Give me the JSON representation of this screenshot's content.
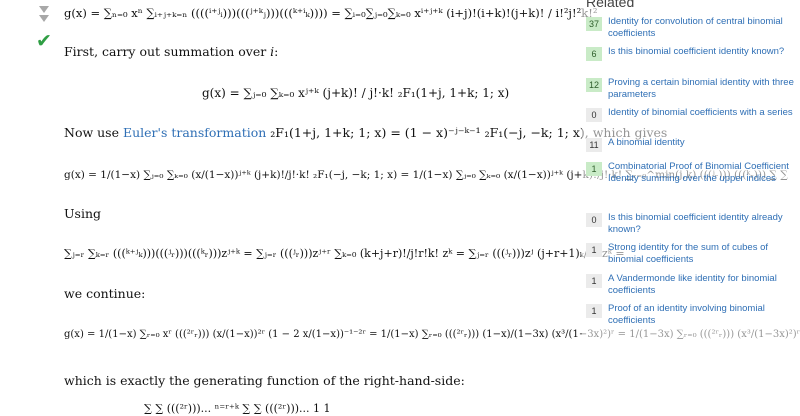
{
  "answer": {
    "eq1": "g(x) = ∑ₙ₌₀ xⁿ ∑ᵢ₊ⱼ₊ₖ₌ₙ ((((ⁱ⁺ʲᵢ)))(((ʲ⁺ᵏⱼ)))(((ᵏ⁺ⁱₖ)))) = ∑ᵢ₌₀∑ⱼ₌₀∑ₖ₌₀ xⁱ⁺ʲ⁺ᵏ (i+j)!(i+k)!(j+k)! / i!²j!²k!²",
    "p1_prefix": "First, carry out summation over ",
    "p1_var": "i",
    "p1_suffix": ":",
    "eq2": "g(x) = ∑ⱼ₌₀ ∑ₖ₌₀ xʲ⁺ᵏ (j+k)! / j!·k! ₂F₁(1+j, 1+k; 1; x)",
    "p2_prefix": "Now use ",
    "p2_link": "Euler's transformation",
    "p2_suffix": " ₂F₁(1+j, 1+k; 1; x) = (1 − x)⁻ʲ⁻ᵏ⁻¹ ₂F₁(−j, −k; 1; x), which gives",
    "eq3": "g(x) = 1/(1−x) ∑ⱼ₌₀ ∑ₖ₌₀ (x/(1−x))ʲ⁺ᵏ (j+k)!/j!·k! ₂F₁(−j, −k; 1; x) = 1/(1−x) ∑ⱼ₌₀ ∑ₖ₌₀ (x/(1−x))ʲ⁺ᵏ (j+k)!/j!·k! ∑ᵣ₌₀^min(j,k) (((ʲᵣ))) (((ᵏᵣ))) ∑ ∑",
    "p3": "Using",
    "eq4": "∑ⱼ₌ᵣ ∑ₖ₌ᵣ (((ᵏ⁺ʲₖ)))(((ʲᵣ)))(((ᵏᵣ)))zʲ⁺ᵏ = ∑ⱼ₌ᵣ (((ʲᵣ)))zʲ⁺ʳ ∑ₖ₌₀ (k+j+r)!/j!r!k! zᵏ = ∑ⱼ₌ᵣ (((ʲᵣ)))zʲ (j+r+1)ₖ/k! zᵏ =",
    "p4": "we continue:",
    "eq5": "g(x) = 1/(1−x) ∑ᵣ₌₀ xʳ (((²ʳᵣ))) (x/(1−x))²ʳ (1 − 2 x/(1−x))⁻¹⁻²ʳ = 1/(1−x) ∑ᵣ₌₀ (((²ʳᵣ))) (1−x)/(1−3x) (x³/(1−3x)²)ʳ = 1/(1−3x) ∑ᵣ₌₀ (((²ʳᵣ))) (x³/(1−3x)²)ʳ",
    "p5": "which is exactly the generating function of the right-hand-side:",
    "eq6": "∑ ∑ (((²ʳ)))... ⁿ⁼ʳ⁺ᵏ ∑ ∑ (((²ʳ)))... 1 1"
  },
  "related": {
    "title": "Related",
    "items": [
      {
        "count": "37",
        "positive": true,
        "title": "Identity for convolution of central binomial coefficients"
      },
      {
        "count": "6",
        "positive": true,
        "title": "Is this binomial coefficient identity known?"
      },
      {
        "count": "12",
        "positive": true,
        "title": "Proving a certain binomial identity with three parameters"
      },
      {
        "count": "0",
        "positive": false,
        "title": "Identity of binomial coefficients with a series"
      },
      {
        "count": "11",
        "positive": false,
        "title": "A binomial identity"
      },
      {
        "count": "1",
        "positive": true,
        "title": "Combinatorial Proof of Binomial Coefficient Identity summing over the upper indices"
      },
      {
        "count": "0",
        "positive": false,
        "title": "Is this binomial coefficient identity already known?"
      },
      {
        "count": "1",
        "positive": false,
        "title": "Strong identity for the sum of cubes of binomial coefficients"
      },
      {
        "count": "1",
        "positive": false,
        "title": "A Vandermonde like identity for binomial coefficients"
      },
      {
        "count": "1",
        "positive": false,
        "title": "Proof of an identity involving binomial coefficients"
      }
    ]
  }
}
